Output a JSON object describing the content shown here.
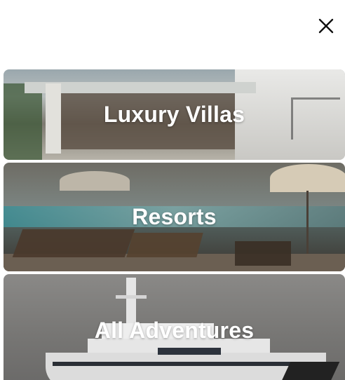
{
  "header": {
    "close_icon": "close-icon"
  },
  "cards": [
    {
      "label": "Luxury Villas",
      "image": "villa-photo"
    },
    {
      "label": "Resorts",
      "image": "resort-pool-photo"
    },
    {
      "label": "All Adventures",
      "image": "yacht-photo"
    }
  ],
  "colors": {
    "background": "#ffffff",
    "label_text": "#ffffff",
    "close_icon": "#111111"
  }
}
